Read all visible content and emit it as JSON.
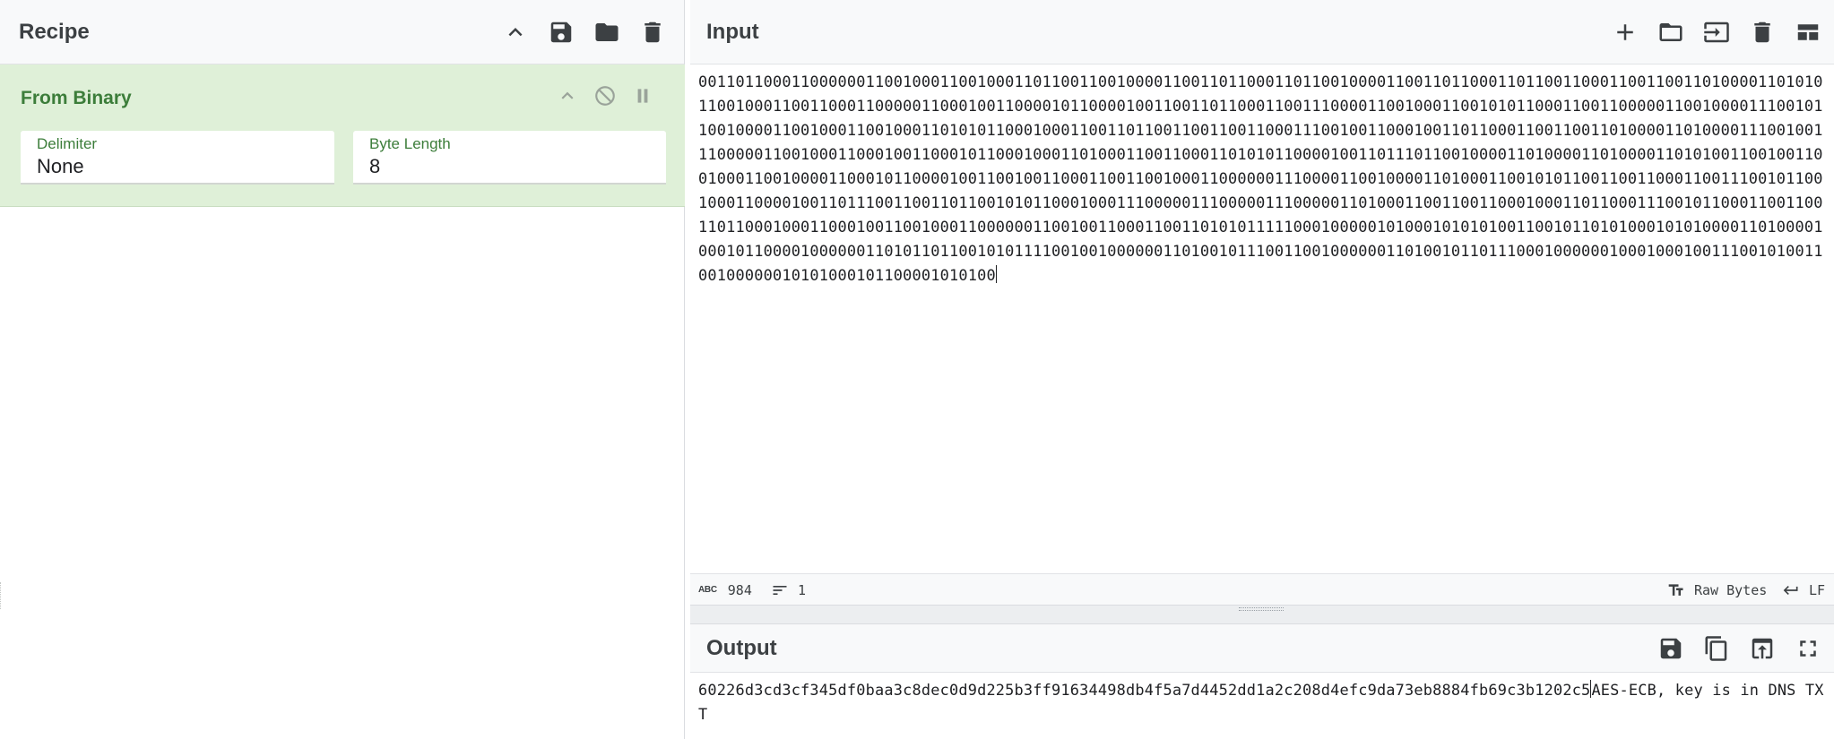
{
  "recipe": {
    "title": "Recipe",
    "operation": {
      "name": "From Binary",
      "args": [
        {
          "label": "Delimiter",
          "value": "None"
        },
        {
          "label": "Byte Length",
          "value": "8"
        }
      ]
    }
  },
  "input": {
    "title": "Input",
    "text": "0011011000110000001100100011001000110110011001000011001101100011011001000011001101100011011001100011001100110100001101010110010001100110001100000110001001100001011000010011001101100011001110000110010001100101011000110011000001100100001110010110010000110010001100100011010101100010001100110110011001100110001110010011000100110110001100110011010000110100001110010011100000110010001100010011000101100010001101000110011000110101011000010011011101100100001101000011010000110101001100100110010001100100001100010110000100110010011000110011001000110000001110000110010000110100011001010110011001100011001110010110010001100001001101110011001101100101011000100011100000111000001110000011010001100110011000100011011000111001011000110011001101100010001100010011001000110000001100100110001100110101011111000100000101000101010100110010110101000101010000110100001000101100001000000110101101100101011110010010000001101001011100110010000001101001011011100010000001000100010011100101001100100000010101000101100001010100",
    "char_count": "984",
    "line_count": "1",
    "encoding": "Raw Bytes",
    "eol": "LF"
  },
  "output": {
    "title": "Output",
    "text_before": "60226d3cd3cf345df0baa3c8dec0d9d225b3ff91634498db4f5a7d4452dd1a2c208d4efc9da73eb8884fb69c3b1202c5",
    "text_after": "AES-ECB, key is in DNS TXT"
  },
  "icons": {
    "collapse": "chevron-up-icon",
    "save": "save-icon",
    "open": "folder-icon",
    "delete": "trash-icon",
    "disable": "disable-icon",
    "pause": "pause-icon",
    "add": "plus-icon",
    "insert": "insert-input-icon",
    "layout": "layout-icon",
    "copy": "copy-icon",
    "replace": "replace-input-icon",
    "maximise": "fullscreen-icon"
  },
  "colors": {
    "operation_bg": "#dff0d8",
    "operation_text": "#3c7d3a",
    "header_bg": "#f8f9fa"
  }
}
